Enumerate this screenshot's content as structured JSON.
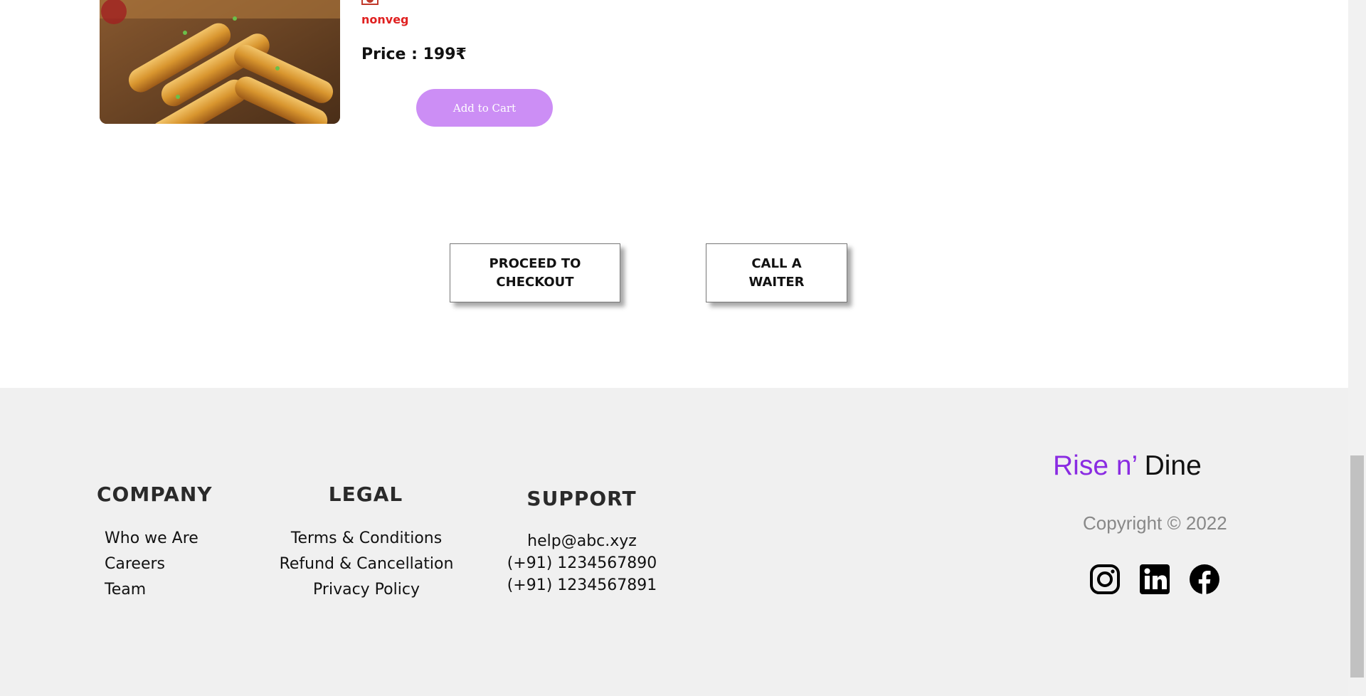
{
  "menu_item": {
    "veg_mark_text": "NON-VEG",
    "veg_type": "nonveg",
    "price": "Price : 199₹",
    "add_to_cart": "Add to Cart"
  },
  "actions": {
    "checkout_line1": "PROCEED TO",
    "checkout_line2": "CHECKOUT",
    "waiter_line1": "CALL A",
    "waiter_line2": "WAITER"
  },
  "footer": {
    "company": {
      "heading": "COMPANY",
      "links": [
        "Who we Are",
        "Careers",
        "Team"
      ]
    },
    "legal": {
      "heading": "LEGAL",
      "links": [
        "Terms & Conditions",
        "Refund & Cancellation",
        "Privacy Policy"
      ]
    },
    "support": {
      "heading": "SUPPORT",
      "email": "help@abc.xyz",
      "phone1": "(+91) 1234567890",
      "phone2": "(+91) 1234567891"
    },
    "brand_part1": "Rise n’",
    "brand_part2": " Dine",
    "copyright": "Copyright © 2022",
    "social": [
      "instagram-icon",
      "linkedin-icon",
      "facebook-icon"
    ]
  },
  "colors": {
    "accent_purple": "#8a2be2",
    "button_purple": "#cc8ef5",
    "nonveg_red": "#e02020",
    "footer_bg": "#f0f0f0"
  }
}
